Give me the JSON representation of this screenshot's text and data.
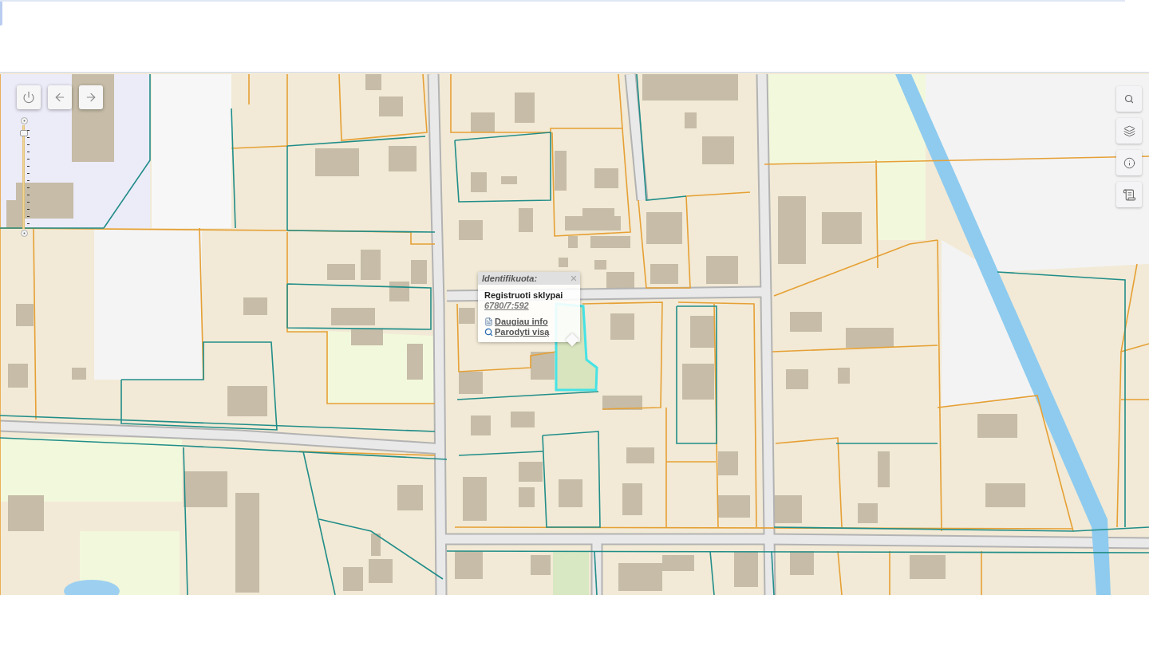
{
  "map": {
    "zoom_slider": {
      "level": 0.95
    },
    "popup": {
      "title": "Identifikuota:",
      "layer": "Registruoti sklypai",
      "parcel_id": "6780/7:592",
      "links": [
        "Daugiau info",
        "Parodyti visą"
      ]
    }
  }
}
